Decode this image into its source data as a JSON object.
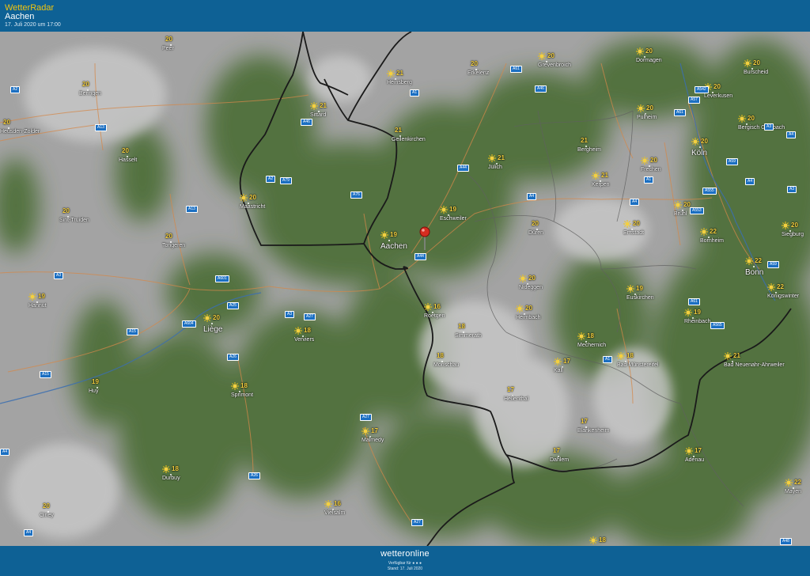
{
  "header": {
    "brand": "WetterRadar",
    "location": "Aachen",
    "timestamp": "17. Juli 2020 um 17:00"
  },
  "footer": {
    "logo": "wetteronline",
    "availability": "Verfügbar für",
    "stand": "Stand: 17. Juli 2020"
  },
  "colors": {
    "header_bg": "#0e6195",
    "temp": "#f4d03f",
    "road": "#1b6fc2",
    "border": "#1a1a1a",
    "forest": "#4d6d3a"
  },
  "map": {
    "cities": [
      {
        "name": "Peer",
        "temp": "20",
        "sun": false
      },
      {
        "name": "Beringen",
        "temp": "20",
        "sun": false
      },
      {
        "name": "Heusden-Zolder",
        "temp": "20",
        "sun": false
      },
      {
        "name": "Hasselt",
        "temp": "20",
        "sun": false
      },
      {
        "name": "Sint-Truiden",
        "temp": "20",
        "sun": false
      },
      {
        "name": "Tongeren",
        "temp": "20",
        "sun": false
      },
      {
        "name": "Hannut",
        "temp": "19",
        "sun": true
      },
      {
        "name": "Liège",
        "temp": "20",
        "sun": true,
        "big": true
      },
      {
        "name": "Huy",
        "temp": "19",
        "sun": false
      },
      {
        "name": "Ciney",
        "temp": "20",
        "sun": false
      },
      {
        "name": "Durbuy",
        "temp": "18",
        "sun": true
      },
      {
        "name": "Vielsalm",
        "temp": "16",
        "sun": true
      },
      {
        "name": "Malmedy",
        "temp": "17",
        "sun": true
      },
      {
        "name": "Sprimont",
        "temp": "18",
        "sun": true
      },
      {
        "name": "Verviers",
        "temp": "18",
        "sun": true
      },
      {
        "name": "Maastricht",
        "temp": "20",
        "sun": true
      },
      {
        "name": "Sittard",
        "temp": "21",
        "sun": true
      },
      {
        "name": "Heinsberg",
        "temp": "21",
        "sun": true
      },
      {
        "name": "Geilenkirchen",
        "temp": "21",
        "sun": false
      },
      {
        "name": "Erkelenz",
        "temp": "20",
        "sun": false
      },
      {
        "name": "Grevenbroich",
        "temp": "20",
        "sun": true
      },
      {
        "name": "Dormagen",
        "temp": "20",
        "sun": true
      },
      {
        "name": "Burscheid",
        "temp": "20",
        "sun": true
      },
      {
        "name": "Leverkusen",
        "temp": "20",
        "sun": true
      },
      {
        "name": "Pulheim",
        "temp": "20",
        "sun": true
      },
      {
        "name": "Bergisch Gladbach",
        "temp": "20",
        "sun": true
      },
      {
        "name": "Köln",
        "temp": "20",
        "sun": true,
        "big": true
      },
      {
        "name": "Bergheim",
        "temp": "21",
        "sun": false
      },
      {
        "name": "Jülich",
        "temp": "21",
        "sun": true
      },
      {
        "name": "Frechen",
        "temp": "20",
        "sun": true
      },
      {
        "name": "Kerpen",
        "temp": "21",
        "sun": true
      },
      {
        "name": "Aachen",
        "temp": "19",
        "sun": true,
        "big": true
      },
      {
        "name": "Eschweiler",
        "temp": "19",
        "sun": true
      },
      {
        "name": "Düren",
        "temp": "20",
        "sun": false
      },
      {
        "name": "Erftstadt",
        "temp": "20",
        "sun": true
      },
      {
        "name": "Brühl",
        "temp": "20",
        "sun": true
      },
      {
        "name": "Siegburg",
        "temp": "20",
        "sun": true
      },
      {
        "name": "Bornheim",
        "temp": "22",
        "sun": true
      },
      {
        "name": "Bonn",
        "temp": "22",
        "sun": true,
        "big": true
      },
      {
        "name": "Königswinter",
        "temp": "22",
        "sun": true
      },
      {
        "name": "Nideggen",
        "temp": "20",
        "sun": true
      },
      {
        "name": "Heimbach",
        "temp": "20",
        "sun": true
      },
      {
        "name": "Euskirchen",
        "temp": "19",
        "sun": true
      },
      {
        "name": "Rheinbach",
        "temp": "19",
        "sun": true
      },
      {
        "name": "Roetgen",
        "temp": "16",
        "sun": true
      },
      {
        "name": "Simmerath",
        "temp": "18",
        "sun": false
      },
      {
        "name": "Monschau",
        "temp": "18",
        "sun": false
      },
      {
        "name": "Mechernich",
        "temp": "18",
        "sun": true
      },
      {
        "name": "Kall",
        "temp": "17",
        "sun": true
      },
      {
        "name": "Bad Münstereifel",
        "temp": "18",
        "sun": true
      },
      {
        "name": "Bad Neuenahr-Ahrweiler",
        "temp": "21",
        "sun": true
      },
      {
        "name": "Hellenthal",
        "temp": "17",
        "sun": false
      },
      {
        "name": "Blankenheim",
        "temp": "17",
        "sun": false
      },
      {
        "name": "Dahlem",
        "temp": "17",
        "sun": false
      },
      {
        "name": "Adenau",
        "temp": "17",
        "sun": true
      },
      {
        "name": "Mayen",
        "temp": "22",
        "sun": true
      },
      {
        "name": "",
        "temp": "18",
        "sun": true
      }
    ],
    "roads": [
      "A61",
      "A46",
      "A542",
      "A2",
      "A46",
      "A1",
      "A57",
      "A61",
      "A3",
      "A4",
      "A13",
      "A2",
      "A79",
      "A76",
      "A44",
      "A4",
      "A59",
      "A555",
      "A4",
      "A553",
      "A59",
      "A3",
      "A4",
      "A1",
      "A44",
      "A13",
      "A601",
      "A3",
      "A61",
      "A604",
      "A25",
      "A3",
      "A27",
      "A565",
      "A1",
      "A15",
      "A15",
      "A26",
      "A27",
      "A26",
      "A27",
      "A4",
      "A4",
      "A48"
    ]
  }
}
